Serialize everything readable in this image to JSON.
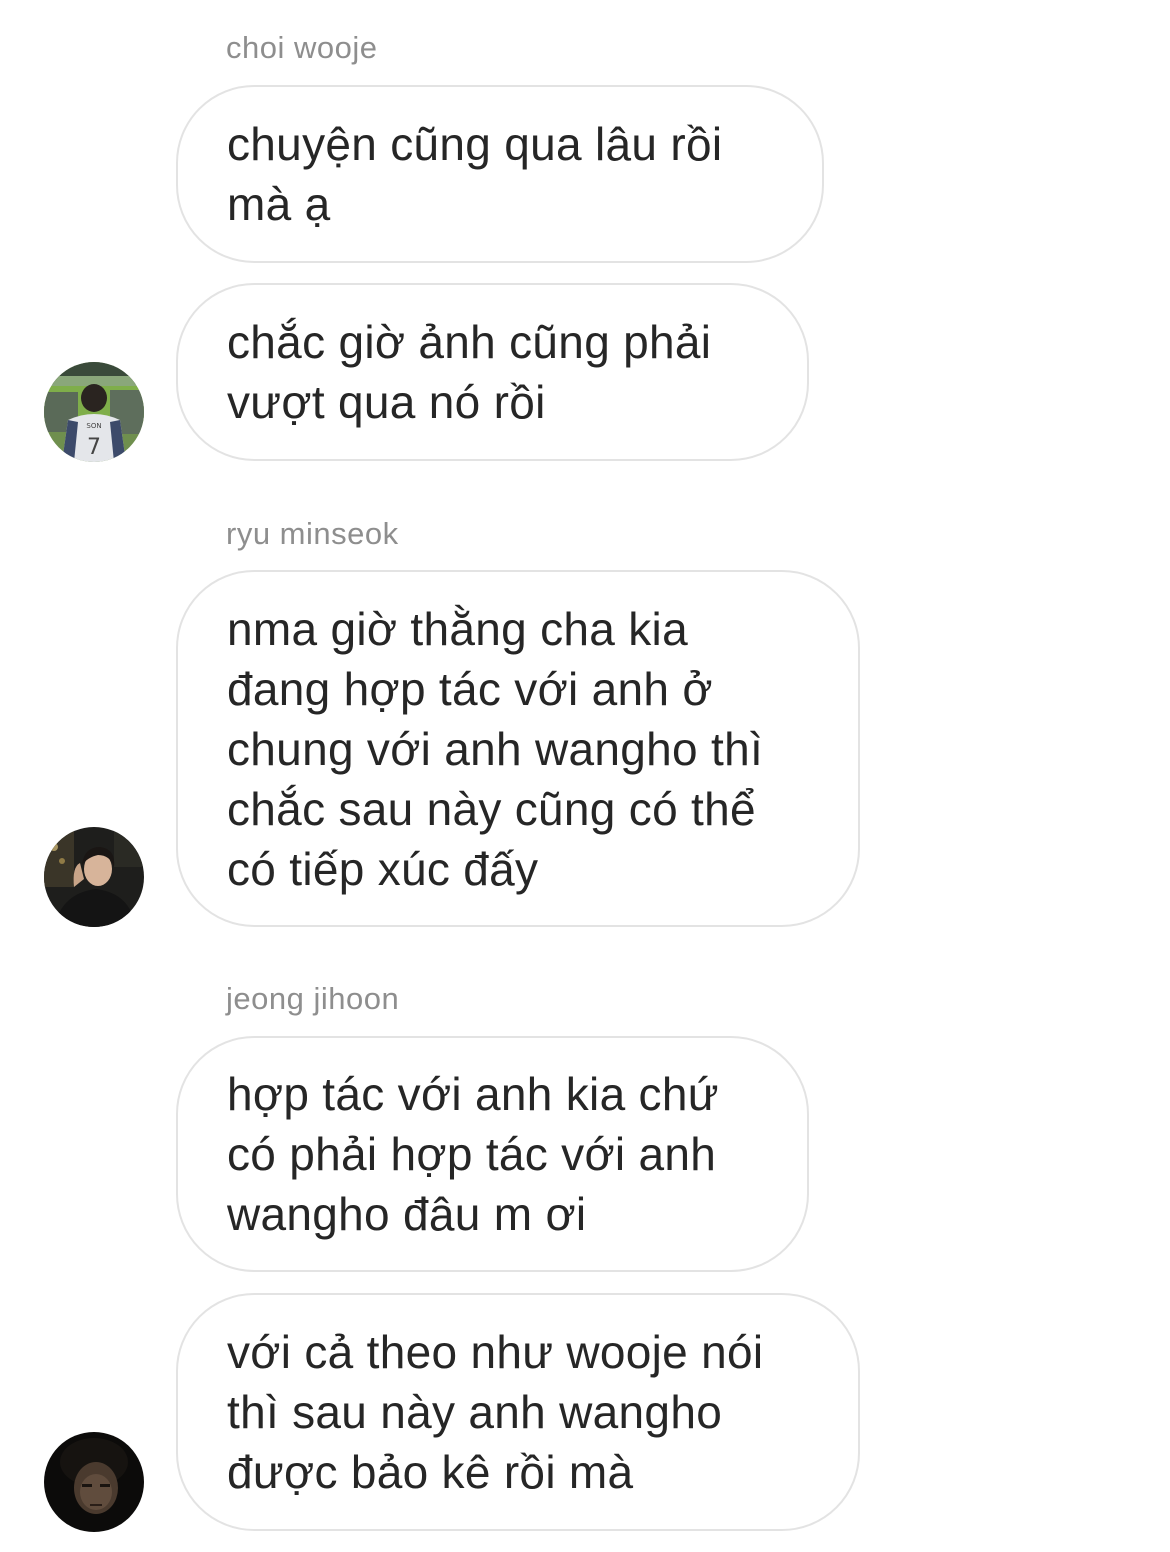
{
  "messages": [
    {
      "sender": "choi wooje",
      "bubbles": [
        "chuyện cũng qua lâu rồi\nmà ạ",
        "chắc giờ ảnh cũng phải\nvượt qua nó rồi"
      ]
    },
    {
      "sender": "ryu minseok",
      "bubbles": [
        "nma giờ thằng cha kia\nđang hợp tác với anh ở\nchung với anh wangho thì\nchắc sau này cũng có thể\ncó tiếp xúc đấy"
      ]
    },
    {
      "sender": "jeong jihoon",
      "bubbles": [
        "hợp tác với anh kia chứ\ncó phải hợp tác với anh\nwangho đâu m ơi",
        "với cả theo như wooje nói\nthì sau này anh wangho\nđược bảo kê rồi mà"
      ]
    }
  ],
  "avatars": [
    {
      "icon": "avatar-stadium-jersey",
      "jersey_text": "SON",
      "jersey_number": "7"
    },
    {
      "icon": "avatar-man-dark"
    },
    {
      "icon": "avatar-face-dark"
    }
  ]
}
